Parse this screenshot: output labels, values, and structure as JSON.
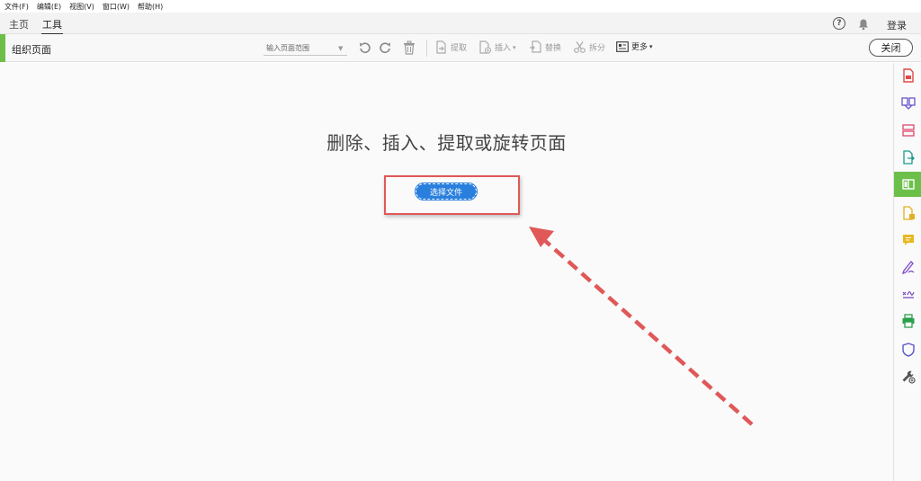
{
  "menu": {
    "items": [
      "文件(F)",
      "编辑(E)",
      "视图(V)",
      "窗口(W)",
      "帮助(H)"
    ]
  },
  "tabs": {
    "home": "主页",
    "tools": "工具"
  },
  "header": {
    "help_glyph": "?",
    "login": "登录"
  },
  "toolbar": {
    "title": "组织页面",
    "range_placeholder": "输入页面范围",
    "extract": "提取",
    "insert": "插入",
    "replace": "替换",
    "split": "拆分",
    "more": "更多",
    "close": "关闭"
  },
  "main": {
    "headline": "删除、插入、提取或旋转页面",
    "choose_file": "选择文件"
  },
  "colors": {
    "accent_green": "#6cc04a",
    "button_blue": "#2a7fde",
    "annotation_red": "#e05858"
  },
  "rail": {
    "icons": [
      "create-pdf-icon",
      "combine-files-icon",
      "organize-pages-icon",
      "export-pdf-icon",
      "organize-pages-active-icon",
      "edit-pdf-icon",
      "comment-icon",
      "fill-sign-icon",
      "send-for-signature-icon",
      "print-production-icon",
      "protect-icon",
      "more-tools-icon"
    ],
    "active_index": 4
  }
}
